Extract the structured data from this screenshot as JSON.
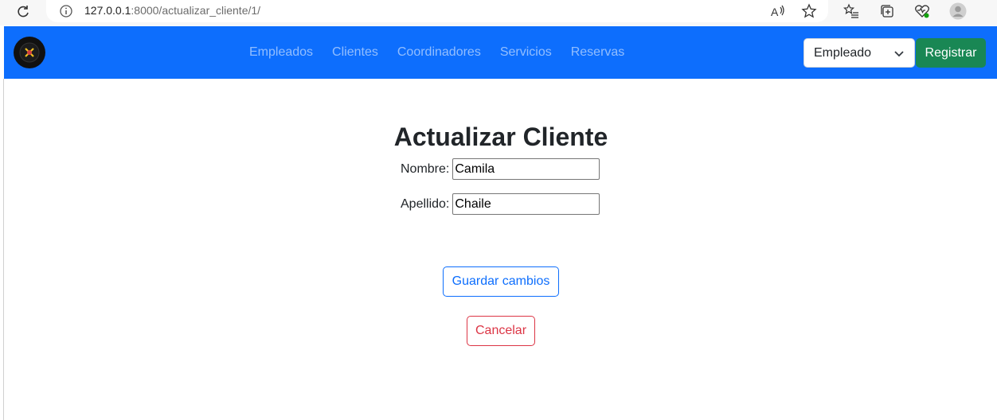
{
  "browser": {
    "url_host": "127.0.0.1",
    "url_path": ":8000/actualizar_cliente/1/",
    "icons": [
      "reload-icon",
      "info-icon",
      "read-aloud-icon",
      "favorite-star-icon",
      "favorites-list-icon",
      "collections-icon",
      "health-icon",
      "profile-avatar-icon"
    ]
  },
  "navbar": {
    "links": [
      "Empleados",
      "Clientes",
      "Coordinadores",
      "Servicios",
      "Reservas"
    ],
    "role_select": "Empleado",
    "register_label": "Registrar",
    "colors": {
      "bar": "#0d6efd",
      "register": "#198754"
    }
  },
  "form": {
    "title": "Actualizar Cliente",
    "nombre_label": "Nombre:",
    "nombre_value": "Camila",
    "apellido_label": "Apellido:",
    "apellido_value": "Chaile",
    "save_label": "Guardar cambios",
    "cancel_label": "Cancelar"
  }
}
